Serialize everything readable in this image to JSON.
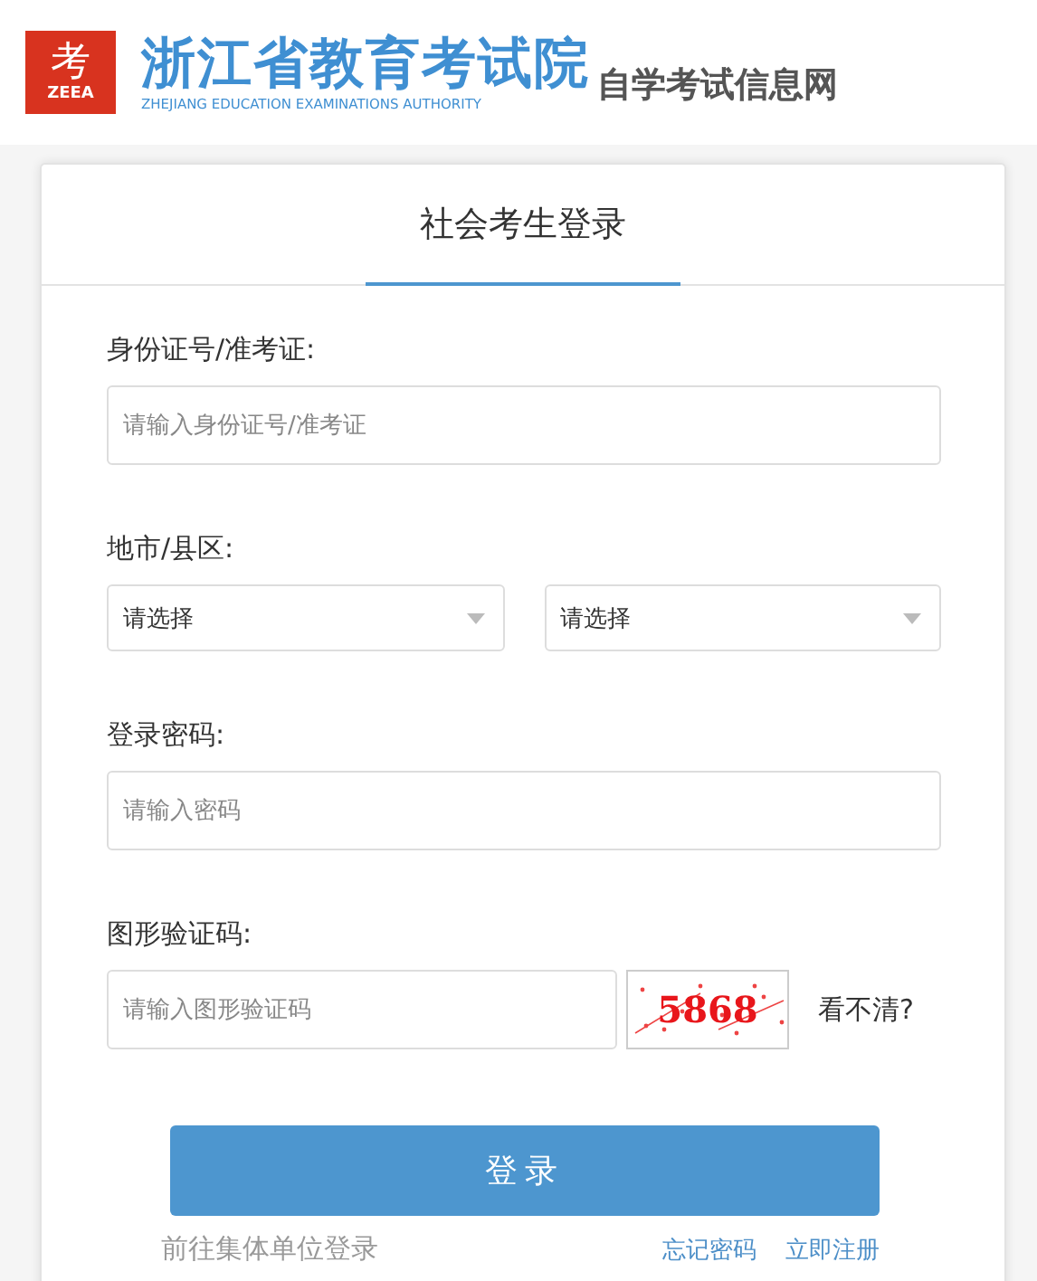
{
  "header": {
    "logo_glyph": "考",
    "logo_abbr": "ZEEA",
    "title": "浙江省教育考试院",
    "subtitle": "ZHEJIANG EDUCATION EXAMINATIONS AUTHORITY",
    "site": "自学考试信息网"
  },
  "login": {
    "tab": "社会考生登录",
    "id_field": {
      "label": "身份证号/准考证:",
      "placeholder": "请输入身份证号/准考证"
    },
    "region": {
      "label": "地市/县区:",
      "selects": [
        {
          "value": "请选择"
        },
        {
          "value": "请选择"
        }
      ]
    },
    "password": {
      "label": "登录密码:",
      "placeholder": "请输入密码"
    },
    "captcha": {
      "label": "图形验证码:",
      "placeholder": "请输入图形验证码",
      "code": "5868",
      "refresh": "看不清?"
    },
    "submit": "登录",
    "group_link": "前往集体单位登录",
    "links": [
      "忘记密码",
      "立即注册"
    ]
  }
}
